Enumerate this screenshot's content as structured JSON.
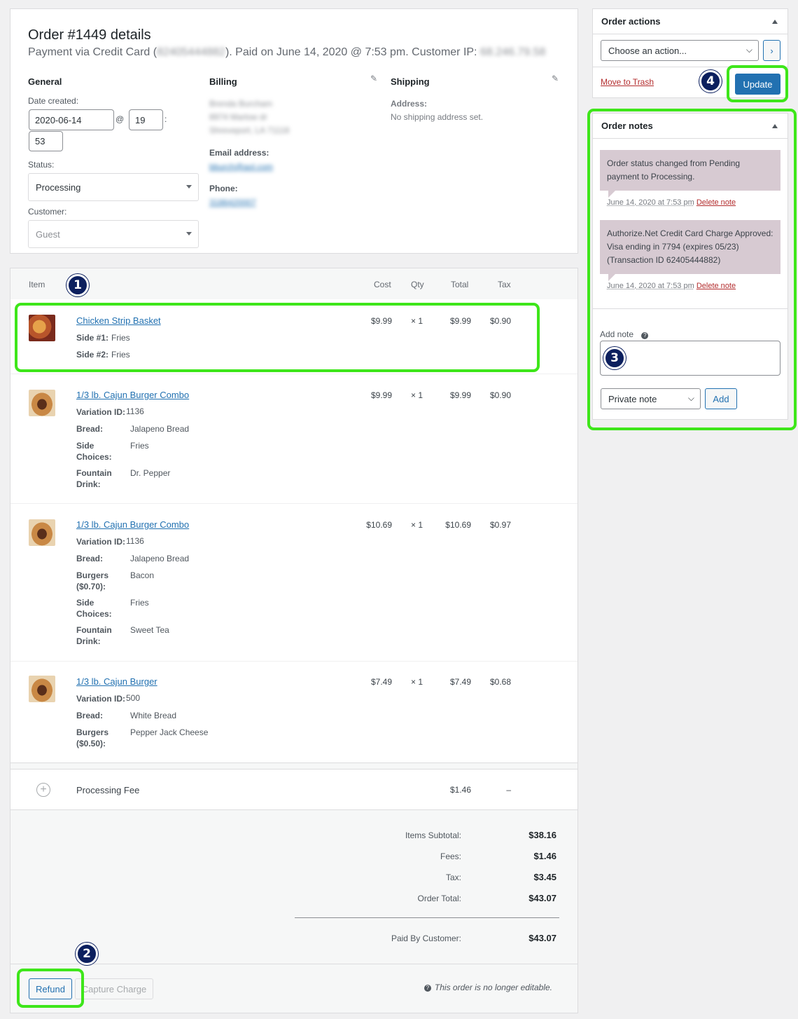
{
  "order": {
    "title": "Order #1449 details",
    "payment_prefix": "Payment via Credit Card (",
    "payment_card_blurred": "82405444882",
    "payment_mid": "). Paid on June 14, 2020 @ 7:53 pm. Customer IP:",
    "customer_ip_blurred": "68.246.79.58"
  },
  "general": {
    "heading": "General",
    "date_label": "Date created:",
    "date_value": "2020-06-14",
    "at": "@",
    "hour": "19",
    "colon": ":",
    "minute": "53",
    "status_label": "Status:",
    "status_value": "Processing",
    "customer_label": "Customer:",
    "customer_value": "Guest"
  },
  "billing": {
    "heading": "Billing",
    "name_blurred": "Brenda Burcham",
    "street_blurred": "8974 Marlow dr",
    "city_blurred": "Shreveport, LA 71118",
    "email_label": "Email address:",
    "email_blurred": "bburch@aol.com",
    "phone_label": "Phone:",
    "phone_blurred": "3186420007"
  },
  "shipping": {
    "heading": "Shipping",
    "address_label": "Address:",
    "address_value": "No shipping address set."
  },
  "items_table": {
    "headers": {
      "item": "Item",
      "cost": "Cost",
      "qty": "Qty",
      "total": "Total",
      "tax": "Tax"
    },
    "items": [
      {
        "name": "Chicken Strip Basket",
        "cost": "$9.99",
        "qty": "× 1",
        "total": "$9.99",
        "tax": "$0.90",
        "meta": [
          {
            "k": "Side #1:",
            "v": "Fries"
          },
          {
            "k": "Side #2:",
            "v": "Fries"
          }
        ]
      },
      {
        "name": "1/3 lb. Cajun Burger Combo",
        "cost": "$9.99",
        "qty": "× 1",
        "total": "$9.99",
        "tax": "$0.90",
        "variation_label": "Variation ID:",
        "variation_id": "1136",
        "meta": [
          {
            "k": "Bread:",
            "v": "Jalapeno Bread"
          },
          {
            "k": "Side Choices:",
            "v": "Fries"
          },
          {
            "k": "Fountain Drink:",
            "v": "Dr. Pepper"
          }
        ]
      },
      {
        "name": "1/3 lb. Cajun Burger Combo",
        "cost": "$10.69",
        "qty": "× 1",
        "total": "$10.69",
        "tax": "$0.97",
        "variation_label": "Variation ID:",
        "variation_id": "1136",
        "meta": [
          {
            "k": "Bread:",
            "v": "Jalapeno Bread"
          },
          {
            "k": "Burgers ($0.70):",
            "v": "Bacon"
          },
          {
            "k": "Side Choices:",
            "v": "Fries"
          },
          {
            "k": "Fountain Drink:",
            "v": "Sweet Tea"
          }
        ]
      },
      {
        "name": "1/3 lb. Cajun Burger",
        "cost": "$7.49",
        "qty": "× 1",
        "total": "$7.49",
        "tax": "$0.68",
        "variation_label": "Variation ID:",
        "variation_id": "500",
        "meta": [
          {
            "k": "Bread:",
            "v": "White Bread"
          },
          {
            "k": "Burgers ($0.50):",
            "v": "Pepper Jack Cheese"
          }
        ]
      }
    ],
    "fee": {
      "name": "Processing Fee",
      "total": "$1.46",
      "tax": "–"
    }
  },
  "totals": {
    "subtotal_label": "Items Subtotal:",
    "subtotal": "$38.16",
    "fees_label": "Fees:",
    "fees": "$1.46",
    "tax_label": "Tax:",
    "tax": "$3.45",
    "order_total_label": "Order Total:",
    "order_total": "$43.07",
    "paid_label": "Paid By Customer:",
    "paid": "$43.07"
  },
  "footer": {
    "refund": "Refund",
    "capture": "Capture Charge",
    "not_editable": "This order is no longer editable."
  },
  "order_actions": {
    "heading": "Order actions",
    "select_value": "Choose an action...",
    "trash": "Move to Trash",
    "update": "Update"
  },
  "order_notes": {
    "heading": "Order notes",
    "notes": [
      {
        "text": "Order status changed from Pending payment to Processing.",
        "date": "June 14, 2020 at 7:53 pm",
        "delete": "Delete note"
      },
      {
        "text": "Authorize.Net Credit Card Charge Approved: Visa ending in 7794 (expires 05/23) (Transaction ID 62405444882)",
        "date": "June 14, 2020 at 7:53 pm",
        "delete": "Delete note"
      }
    ],
    "add_label": "Add note",
    "type_value": "Private note",
    "add_button": "Add"
  },
  "callouts": [
    "1",
    "2",
    "3",
    "4"
  ],
  "colors": {
    "highlight": "#3ee61a",
    "badge": "#0b1f5e",
    "accent": "#2271b1",
    "note_bg": "#d7cad2"
  }
}
